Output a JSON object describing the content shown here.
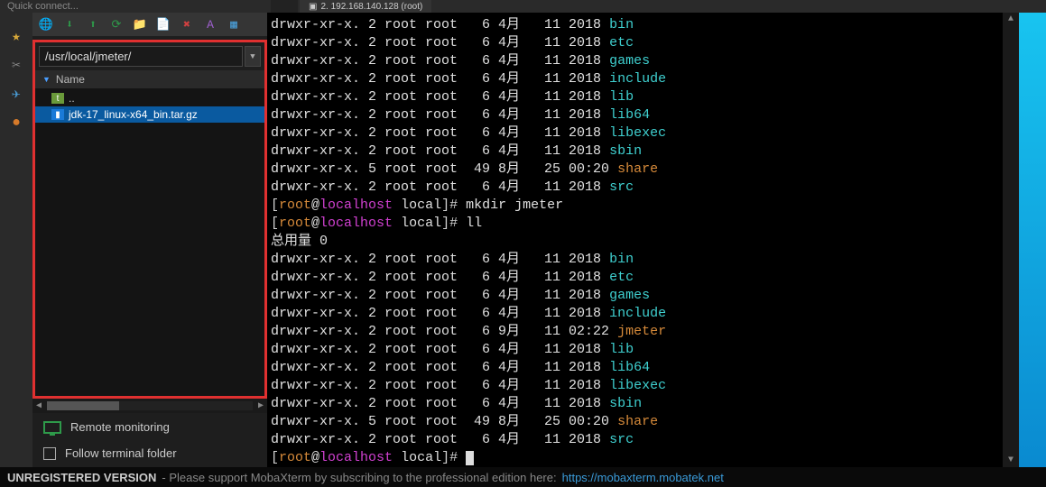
{
  "quick_connect": "Quick connect...",
  "tab_label": "2. 192.168.140.128 (root)",
  "toolbar_icons": [
    "globe",
    "download",
    "upload",
    "refresh",
    "folder",
    "copy",
    "delete",
    "font",
    "app"
  ],
  "path_value": "/usr/local/jmeter/",
  "file_header_label": "Name",
  "files": {
    "parent": "..",
    "selected": "jdk-17_linux-x64_bin.tar.gz"
  },
  "side_footer": {
    "remote_monitoring": "Remote monitoring",
    "follow_terminal": "Follow terminal folder"
  },
  "terminal": {
    "perm_dir2": "drwxr-xr-x. 2",
    "perm_dir5": "drwxr-xr-x. 5",
    "own": "root root",
    "s6": "  6",
    "s49": " 49",
    "m4": "4月",
    "m8": "8月",
    "m9": "9月",
    "d11": "  11",
    "d25": "  25",
    "y2018": "2018",
    "t0020": "00:20",
    "t0222": "02:22",
    "totals": "总用量 0",
    "dirs1": [
      "bin",
      "etc",
      "games",
      "include",
      "lib",
      "lib64",
      "libexec",
      "sbin",
      "share",
      "src"
    ],
    "dirs2": [
      "bin",
      "etc",
      "games",
      "include",
      "jmeter",
      "lib",
      "lib64",
      "libexec",
      "sbin",
      "share",
      "src"
    ],
    "prompt_user": "root",
    "prompt_host": "localhost",
    "prompt_dir": "local",
    "cmd_mkdir": "mkdir jmeter",
    "cmd_ll": "ll"
  },
  "status": {
    "unregistered": "UNREGISTERED VERSION",
    "support_text": " -  Please support MobaXterm by subscribing to the professional edition here: ",
    "link": "https://mobaxterm.mobatek.net"
  },
  "colors": {
    "cyan": "#3fd0d0",
    "orange": "#d68a3a",
    "magenta": "#d040d0"
  }
}
